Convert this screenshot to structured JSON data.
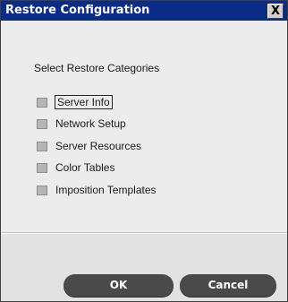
{
  "dialog": {
    "title": "Restore Configuration",
    "close_glyph": "X",
    "heading": "Select Restore Categories"
  },
  "categories": [
    {
      "label": "Server Info",
      "checked": false,
      "focused": true
    },
    {
      "label": "Network Setup",
      "checked": false,
      "focused": false
    },
    {
      "label": "Server Resources",
      "checked": false,
      "focused": false
    },
    {
      "label": "Color Tables",
      "checked": false,
      "focused": false
    },
    {
      "label": "Imposition Templates",
      "checked": false,
      "focused": false
    }
  ],
  "buttons": {
    "ok_label": "OK",
    "cancel_label": "Cancel"
  },
  "colors": {
    "titlebar": "#0b2c86",
    "button": "#4a4a4a",
    "checkbox": "#b5b5b5"
  }
}
